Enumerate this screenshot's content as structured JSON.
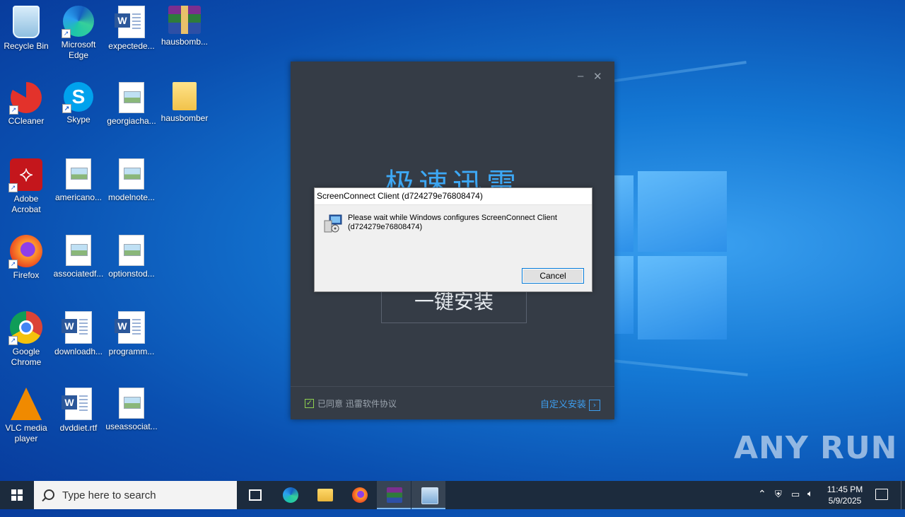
{
  "desktop": {
    "icons": [
      {
        "label": "Recycle Bin",
        "icon": "recycle-bin-icon"
      },
      {
        "label": "Microsoft Edge",
        "icon": "edge-icon"
      },
      {
        "label": "expectede...",
        "icon": "word-doc-icon"
      },
      {
        "label": "hausbomb...",
        "icon": "winrar-archive-icon"
      },
      {
        "label": "CCleaner",
        "icon": "ccleaner-icon"
      },
      {
        "label": "Skype",
        "icon": "skype-icon"
      },
      {
        "label": "georgiacha...",
        "icon": "image-file-icon"
      },
      {
        "label": "hausbomber",
        "icon": "folder-icon"
      },
      {
        "label": "Adobe Acrobat",
        "icon": "acrobat-icon"
      },
      {
        "label": "americano...",
        "icon": "image-file-icon"
      },
      {
        "label": "modelnote...",
        "icon": "image-file-icon"
      },
      {
        "label": "Firefox",
        "icon": "firefox-icon"
      },
      {
        "label": "associatedf...",
        "icon": "image-file-icon"
      },
      {
        "label": "optionstod...",
        "icon": "image-file-icon"
      },
      {
        "label": "Google Chrome",
        "icon": "chrome-icon"
      },
      {
        "label": "downloadh...",
        "icon": "word-doc-icon"
      },
      {
        "label": "programm...",
        "icon": "word-doc-icon"
      },
      {
        "label": "VLC media player",
        "icon": "vlc-icon"
      },
      {
        "label": "dvddiet.rtf",
        "icon": "word-doc-icon"
      },
      {
        "label": "useassociat...",
        "icon": "image-file-icon"
      }
    ]
  },
  "installer": {
    "brand_text": "极速迅雷",
    "install_button": "一键安装",
    "agree_text": "已同意 迅雷软件协议",
    "custom_install": "自定义安装",
    "minimize_glyph": "–",
    "close_glyph": "✕"
  },
  "msi_dialog": {
    "title": "ScreenConnect Client (d724279e76808474)",
    "message": "Please wait while Windows configures ScreenConnect Client (d724279e76808474)",
    "cancel_label": "Cancel"
  },
  "watermark": "ANY RUN",
  "taskbar": {
    "search_placeholder": "Type here to search",
    "time": "11:45 PM",
    "date": "5/9/2025"
  },
  "colors": {
    "accent": "#3da8f5",
    "taskbar": "#1c2b3d",
    "installer_bg": "#353c46"
  }
}
